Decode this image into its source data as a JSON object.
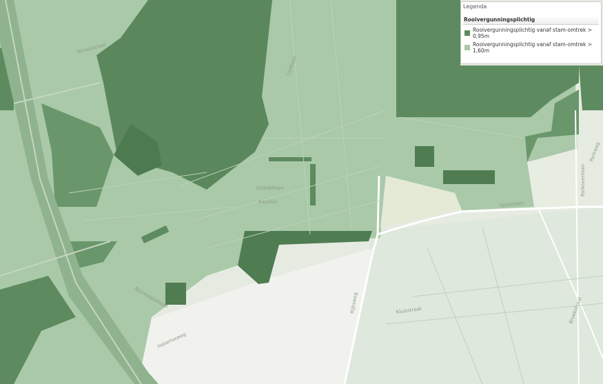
{
  "colors": {
    "dark_green": "#5d8a5e",
    "light_green": "#a9c9a8",
    "background": "#e8ece4"
  },
  "legend": {
    "title": "Legenda",
    "group_title": "Rooivergunningsplichtig",
    "items": [
      {
        "label": "Rooivergunningsplichtig vanaf stam-omtrek > 0,95m",
        "color": "#5d8a5e"
      },
      {
        "label": "Rooivergunningsplichtig vanaf stam-omtrek > 1,60m",
        "color": "#a9c9a8"
      }
    ]
  },
  "streets": {
    "s1": "Winkelstraat",
    "s2": "Lijnbaan",
    "s3": "Citadellaan",
    "s4": "Ravelijn",
    "s5": "Rijksweg",
    "s6": "Kluisstraat",
    "s7": "Broekstraat",
    "s8": "Parkweg",
    "s9": "Parkovenlaan",
    "s10": "Hatertseweg",
    "s11": "Nijmeegsebaan",
    "s12": "Spoorlaan"
  }
}
